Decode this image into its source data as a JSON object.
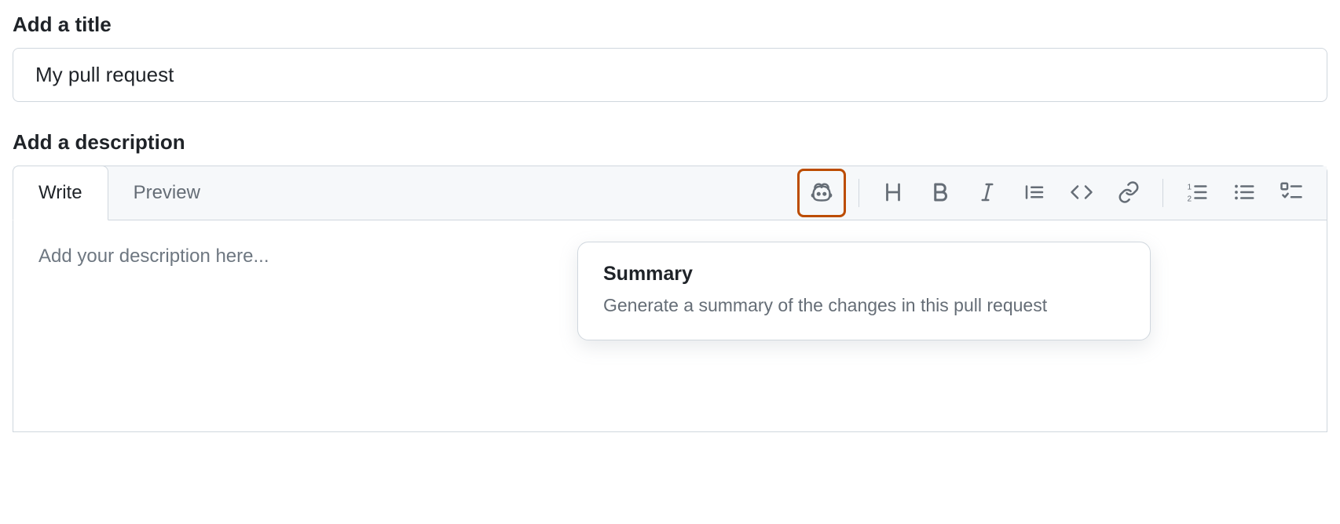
{
  "title_section": {
    "label": "Add a title",
    "value": "My pull request"
  },
  "description_section": {
    "label": "Add a description",
    "tabs": {
      "write": "Write",
      "preview": "Preview"
    },
    "placeholder": "Add your description here..."
  },
  "popover": {
    "title": "Summary",
    "description": "Generate a summary of the changes in this pull request"
  }
}
